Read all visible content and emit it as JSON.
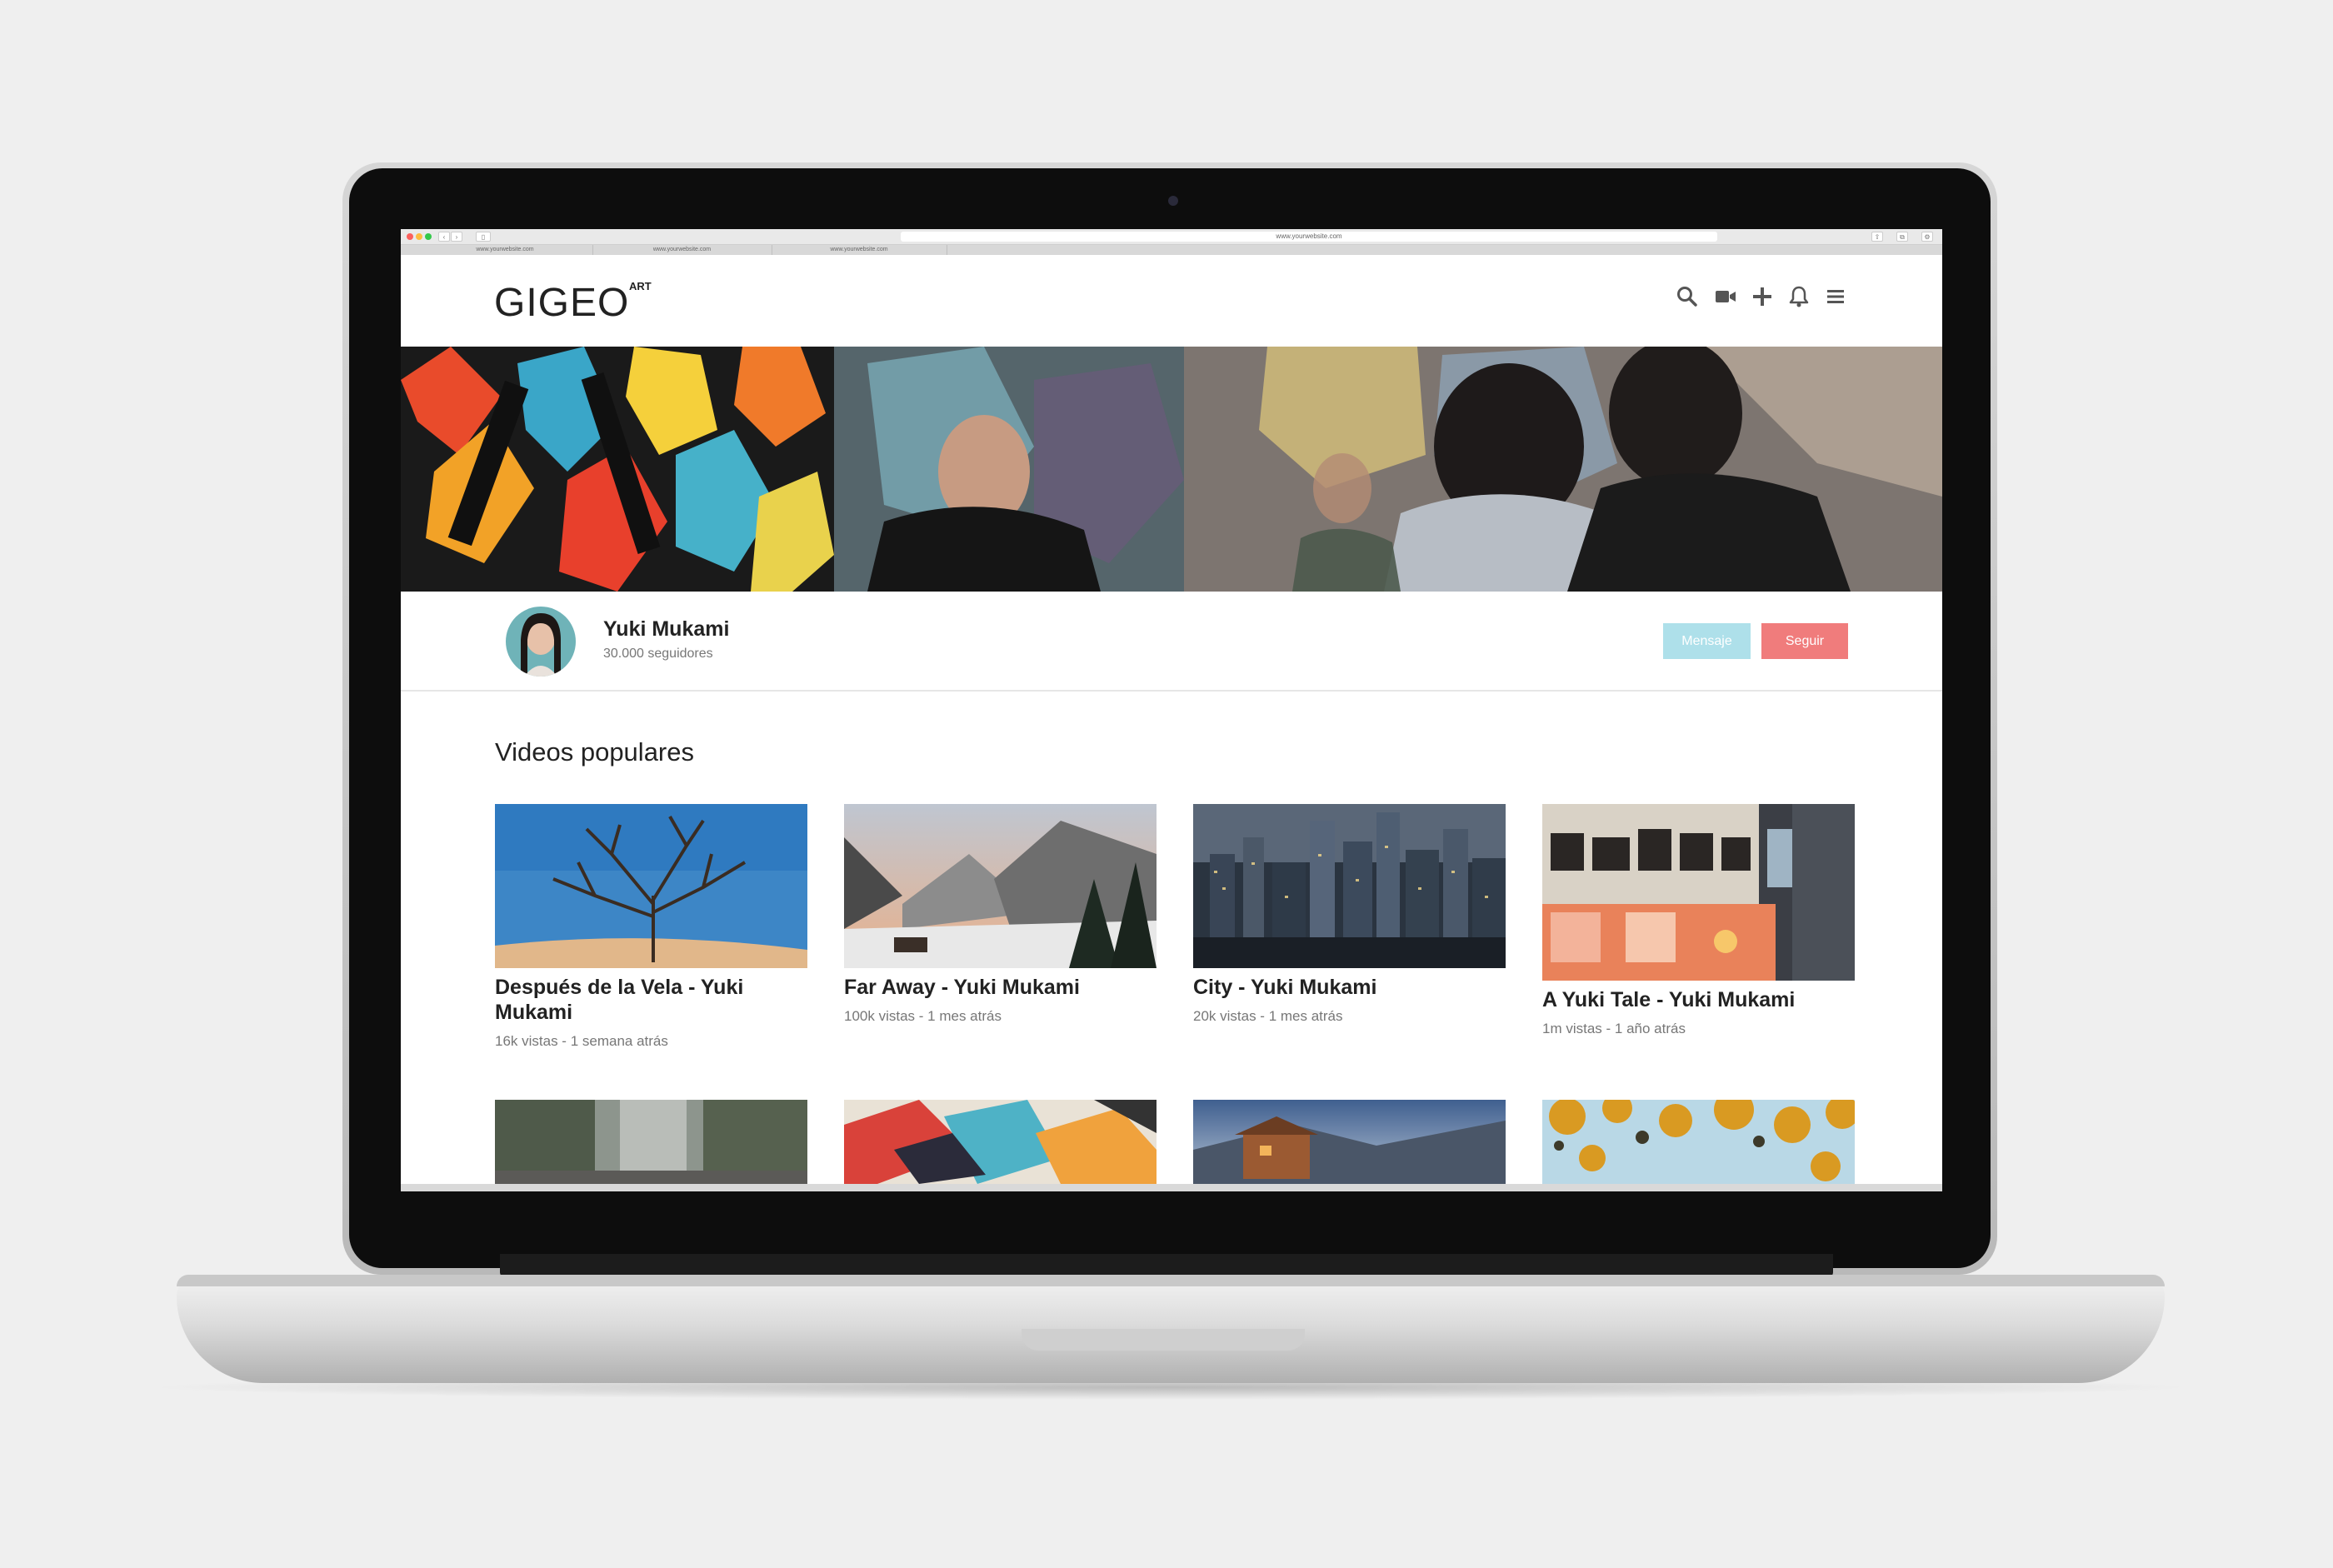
{
  "browser": {
    "url": "www.yourwebsite.com",
    "tabs": [
      "www.yourwebsite.com",
      "www.yourwebsite.com",
      "www.yourwebsite.com"
    ]
  },
  "header": {
    "logo": "GIGEO",
    "logo_sup": "ART",
    "icons": [
      "search-icon",
      "video-camera-icon",
      "plus-icon",
      "bell-icon",
      "menu-icon"
    ]
  },
  "profile": {
    "name": "Yuki Mukami",
    "followers": "30.000 seguidores",
    "message_label": "Mensaje",
    "follow_label": "Seguir"
  },
  "colors": {
    "message_button": "#aee0ea",
    "follow_button": "#f07c7c"
  },
  "section": {
    "title": "Videos populares"
  },
  "videos": [
    {
      "title": "Después de la Vela - Yuki Mukami",
      "meta": "16k vistas - 1 semana atrás"
    },
    {
      "title": "Far Away - Yuki Mukami",
      "meta": "100k vistas - 1 mes atrás"
    },
    {
      "title": "City - Yuki Mukami",
      "meta": "20k vistas - 1 mes atrás"
    },
    {
      "title": "A Yuki Tale - Yuki Mukami",
      "meta": "1m vistas - 1 año atrás"
    }
  ]
}
